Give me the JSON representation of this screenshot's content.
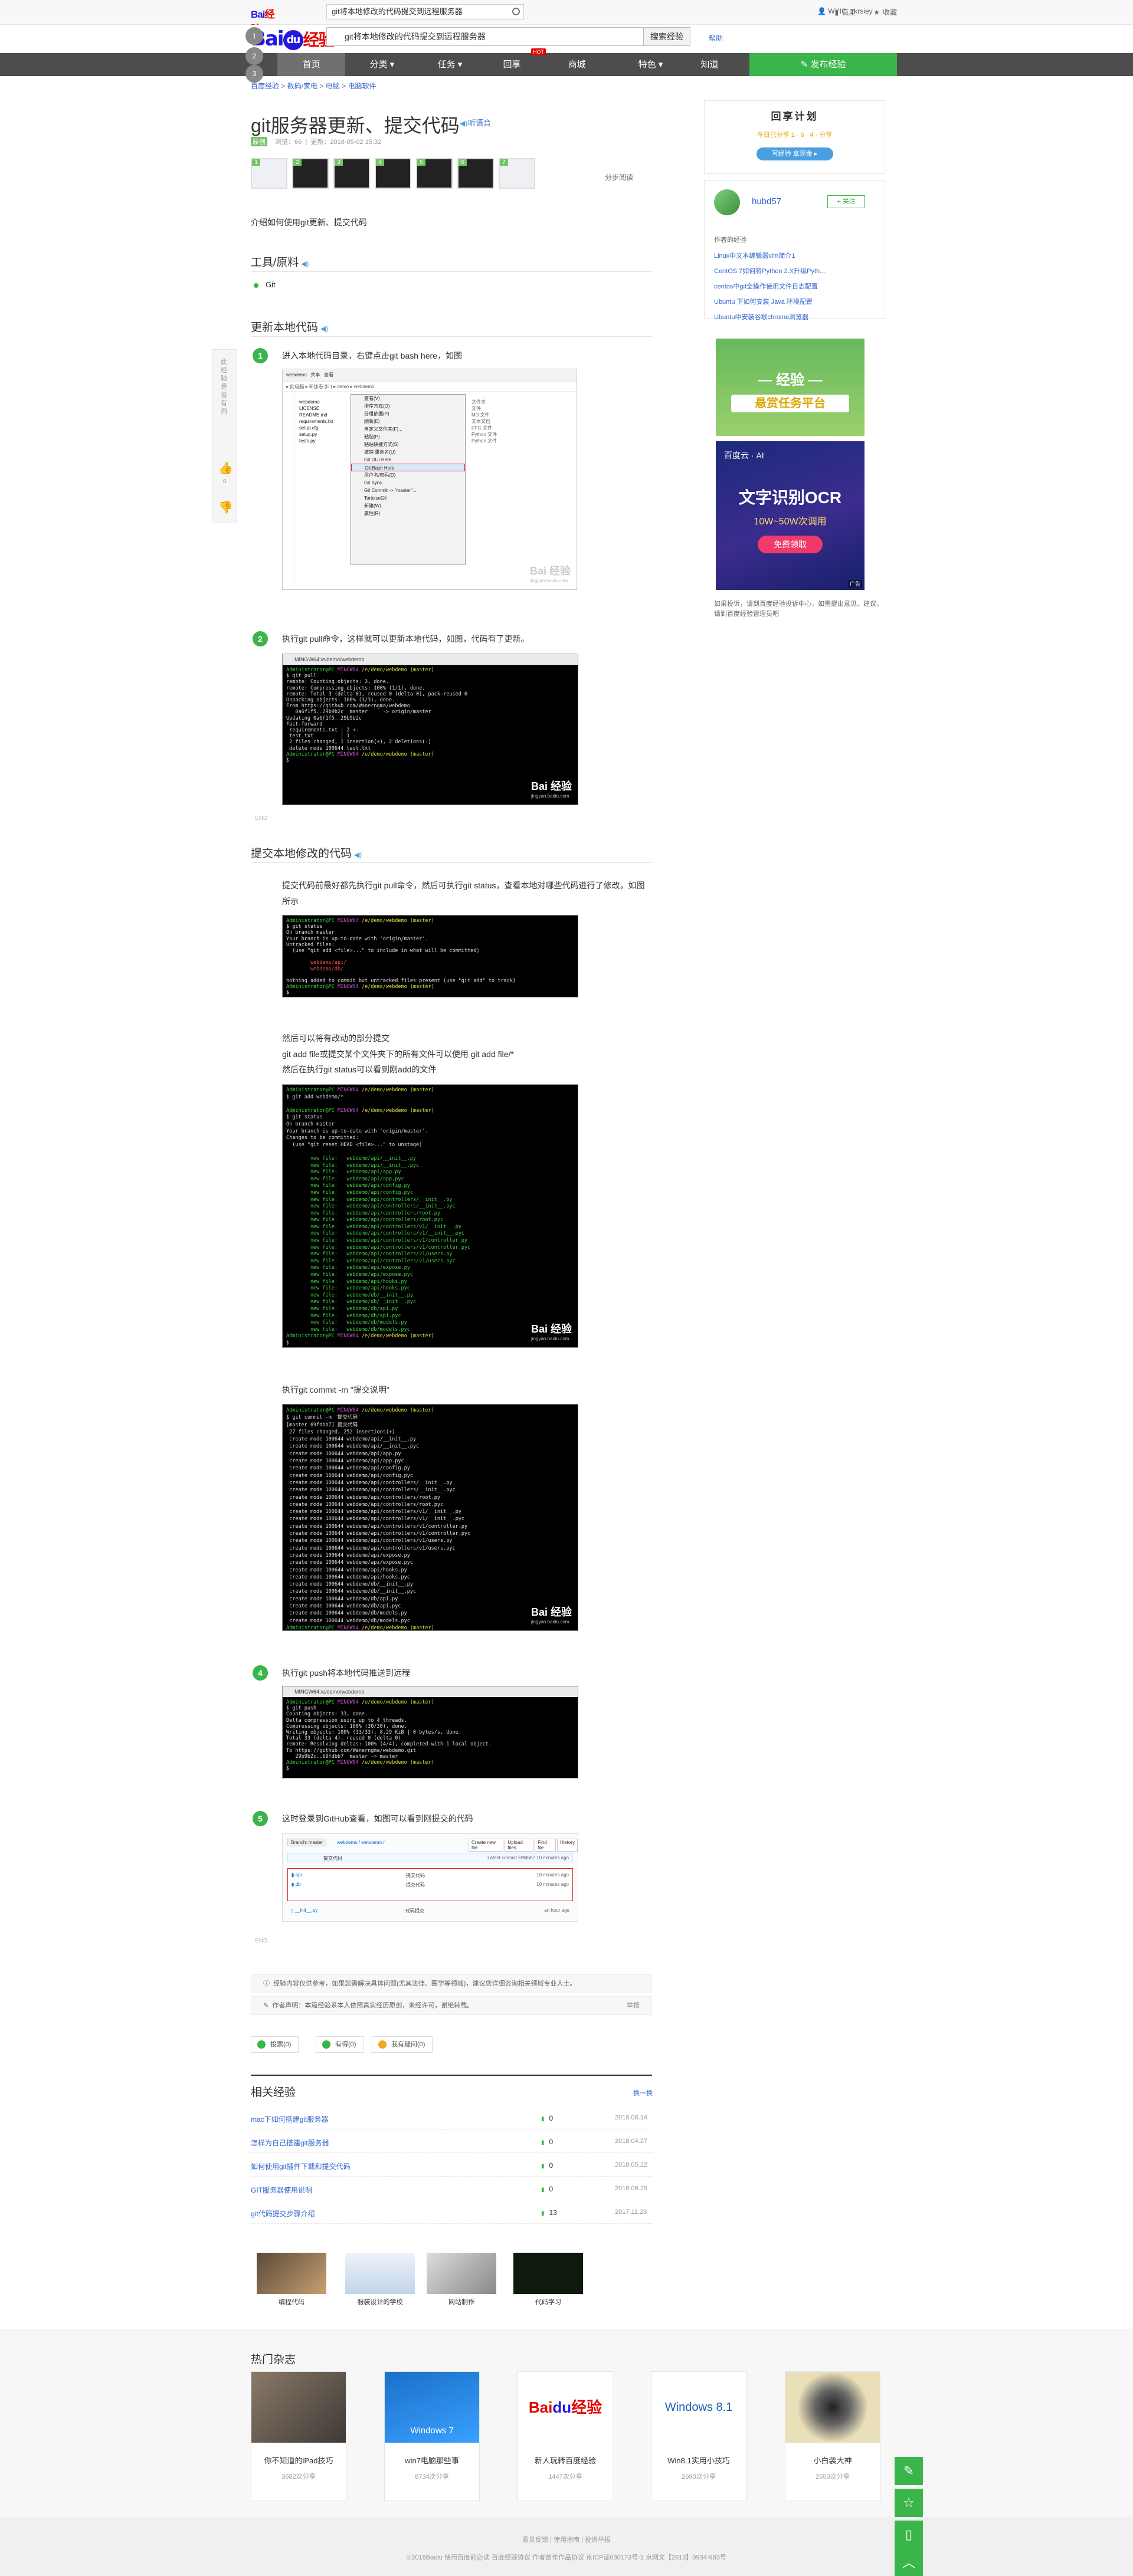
{
  "topbar": {
    "logo_text": "Bai",
    "logo_red": "经验",
    "search_value": "git将本地修改的代码提交到远程服务器",
    "links": [
      "百里",
      "收藏"
    ],
    "user": "WYIC_zkrsiey"
  },
  "header": {
    "logo_text": "Bai",
    "logo_du": "du",
    "logo_jy": "经验",
    "search_value": "git将本地修改的代码提交到远程服务器",
    "search_button": "搜索经验",
    "help": "帮助"
  },
  "nav": {
    "items": [
      "首页",
      "分类 ▾",
      "任务 ▾",
      "回享",
      "商城",
      "特色 ▾",
      "知道"
    ],
    "hot": "HOT",
    "publish": "✎ 发布经验"
  },
  "left_circles": [
    "1",
    "2",
    "3"
  ],
  "breadcrumb": [
    "百度经验",
    "数码/家电",
    "电脑",
    "电脑软件"
  ],
  "article": {
    "title": "git服务器更新、提交代码",
    "listen": "听语音",
    "meta_level": "原创",
    "meta_views": "浏览：66",
    "meta_date": "更新：2018-05-02 15:32",
    "thumbs": [
      "1",
      "2",
      "3",
      "4",
      "5",
      "6",
      "7"
    ],
    "share": "分步阅读",
    "intro": "介绍如何使用git更新、提交代码"
  },
  "sections": {
    "tools_title": "工具/原料",
    "tools": [
      "Git"
    ],
    "update_title": "更新本地代码",
    "commit_title": "提交本地修改的代码"
  },
  "steps": {
    "s1": {
      "num": "1",
      "text": "进入本地代码目录，右键点击git bash here，如图"
    },
    "s2": {
      "num": "2",
      "text": "执行git pull命令，这样就可以更新本地代码，如图，代码有了更新。"
    },
    "c1": {
      "text": "提交代码前最好都先执行git pull命令，然后可执行git status，查看本地对哪些代码进行了修改，如图所示"
    },
    "c2": {
      "line1": "然后可以将有改动的部分提交",
      "line2": "git add file或提交某个文件夹下的所有文件可以使用 git add file/*",
      "line3": "然后在执行git status可以看到刚add的文件"
    },
    "c3": {
      "text": "执行git commit -m \"提交说明\""
    },
    "s4": {
      "num": "4",
      "text": "执行git push将本地代码推送到远程"
    },
    "s5": {
      "num": "5",
      "text": "这时登录到GitHub查看，如图可以看到刚提交的代码"
    }
  },
  "end_label": "END",
  "explorer": {
    "menu": [
      "查看(V)",
      "排序方式(O)",
      "分组依据(P)",
      "刷新(E)",
      "自定义文件夹(F)...",
      "粘贴(P)",
      "粘贴快捷方式(S)",
      "撤销 重命名(U)",
      "Git GUI Here",
      "Git Bash Here",
      "用户名/密码(D)",
      "Git Sync...",
      "Git Commit -> \"master\"...",
      "TortoiseGit",
      "新建(W)",
      "属性(R)"
    ],
    "files": [
      "webdemo",
      "LICENSE",
      "README.md",
      "requirements.txt",
      "setup.cfg",
      "setup.py",
      "tests.py"
    ]
  },
  "terminals": {
    "path": "MINGW64:/e/demo/webdemo",
    "pull": [
      "$ git pull",
      "remote: Counting objects: 3, done.",
      "remote: Compressing objects: 100% (1/1), done.",
      "remote: Total 3 (delta 0), reused 0 (delta 0), pack-reused 0",
      "Unpacking objects: 100% (3/3), done.",
      "From https://github.com/Wanerngma/webdemo",
      "   0a6f1f5..29b9b2c  master     -> origin/master",
      "Updating 0a6f1f5..29b9b2c",
      "Fast-forward",
      " requirements.txt | 2 +-",
      " test.txt         | 1 -",
      " 2 files changed, 1 insertion(+), 2 deletions(-)",
      " delete mode 100644 test.txt"
    ],
    "status": [
      "$ git status",
      "On branch master",
      "Your branch is up-to-date with 'origin/master'.",
      "Untracked files:",
      "  (use \"git add <file>...\" to include in what will be committed)",
      "",
      "        webdemo/api/",
      "        webdemo/db/",
      "",
      "nothing added to commit but untracked files present (use \"git add\" to track)"
    ],
    "add": [
      "$ git add webdemo/*",
      "",
      "$ git status",
      "On branch master",
      "Your branch is up-to-date with 'origin/master'.",
      "Changes to be committed:",
      "  (use \"git reset HEAD <file>...\" to unstage)",
      "",
      "        new file:   webdemo/api/__init__.py",
      "        new file:   webdemo/api/__init__.pyc",
      "        new file:   webdemo/api/app.py",
      "        new file:   webdemo/api/app.pyc",
      "        new file:   webdemo/api/config.py",
      "        new file:   webdemo/api/config.pyc",
      "        new file:   webdemo/api/controllers/__init__.py",
      "        new file:   webdemo/api/controllers/__init__.pyc",
      "        new file:   webdemo/api/controllers/root.py",
      "        new file:   webdemo/api/controllers/root.pyc",
      "        new file:   webdemo/api/controllers/v1/__init__.py",
      "        new file:   webdemo/api/controllers/v1/__init__.pyc",
      "        new file:   webdemo/api/controllers/v1/controller.py",
      "        new file:   webdemo/api/controllers/v1/controller.pyc",
      "        new file:   webdemo/api/controllers/v1/users.py",
      "        new file:   webdemo/api/controllers/v1/users.pyc",
      "        new file:   webdemo/api/expose.py",
      "        new file:   webdemo/api/expose.pyc",
      "        new file:   webdemo/api/hooks.py",
      "        new file:   webdemo/api/hooks.pyc",
      "        new file:   webdemo/db/__init__.py",
      "        new file:   webdemo/db/__init__.pyc",
      "        new file:   webdemo/db/api.py",
      "        new file:   webdemo/db/api.pyc",
      "        new file:   webdemo/db/models.py",
      "        new file:   webdemo/db/models.pyc"
    ],
    "commit": [
      "$ git commit -m '提交代码'",
      "[master 69fdbb7] 提交代码",
      " 27 files changed, 252 insertions(+)",
      " create mode 100644 webdemo/api/__init__.py",
      " create mode 100644 webdemo/api/__init__.pyc",
      " create mode 100644 webdemo/api/app.py",
      " create mode 100644 webdemo/api/app.pyc",
      " create mode 100644 webdemo/api/config.py",
      " create mode 100644 webdemo/api/config.pyc",
      " create mode 100644 webdemo/api/controllers/__init__.py",
      " create mode 100644 webdemo/api/controllers/__init__.pyc",
      " create mode 100644 webdemo/api/controllers/root.py",
      " create mode 100644 webdemo/api/controllers/root.pyc",
      " create mode 100644 webdemo/api/controllers/v1/__init__.py",
      " create mode 100644 webdemo/api/controllers/v1/__init__.pyc",
      " create mode 100644 webdemo/api/controllers/v1/controller.py",
      " create mode 100644 webdemo/api/controllers/v1/controller.pyc",
      " create mode 100644 webdemo/api/controllers/v1/users.py",
      " create mode 100644 webdemo/api/controllers/v1/users.pyc",
      " create mode 100644 webdemo/api/expose.py",
      " create mode 100644 webdemo/api/expose.pyc",
      " create mode 100644 webdemo/api/hooks.py",
      " create mode 100644 webdemo/api/hooks.pyc",
      " create mode 100644 webdemo/db/__init__.py",
      " create mode 100644 webdemo/db/__init__.pyc",
      " create mode 100644 webdemo/db/api.py",
      " create mode 100644 webdemo/db/api.pyc",
      " create mode 100644 webdemo/db/models.py",
      " create mode 100644 webdemo/db/models.pyc"
    ],
    "push": [
      "$ git push",
      "Counting objects: 33, done.",
      "Delta compression using up to 4 threads.",
      "Compressing objects: 100% (30/30), done.",
      "Writing objects: 100% (33/33), 8.29 KiB | 0 bytes/s, done.",
      "Total 33 (delta 4), reused 0 (delta 0)",
      "remote: Resolving deltas: 100% (4/4), completed with 1 local object.",
      "To https://github.com/Wanerngma/webdemo.git",
      "   29b9b2c..69fdbb7  master -> master"
    ],
    "prompt": "/e/demo/webdemo (master)",
    "watermark": "Bai 经验",
    "watermark_url": "jingyan.baidu.com"
  },
  "github": {
    "branch": "Branch: master",
    "path": "webdemo / webdemo /",
    "buttons": [
      "Create new file",
      "Upload files",
      "Find file",
      "History"
    ],
    "commit_msg": "提交代码",
    "latest": "Latest commit 69fdbb7 10 minutes ago",
    "rows": [
      {
        "name": "api",
        "msg": "提交代码",
        "age": "10 minutes ago"
      },
      {
        "name": "db",
        "msg": "提交代码",
        "age": "10 minutes ago"
      },
      {
        "name": "__init__.py",
        "msg": "代码提交",
        "age": "an hour ago"
      }
    ]
  },
  "notes": {
    "n1": "经验内容仅供参考，如果您需解决具体问题(尤其法律、医学等领域)，建议您详细咨询相关领域专业人士。",
    "n2": "作者声明：本篇经验系本人依照真实经历原创，未经许可，谢绝转载。",
    "report": "举报"
  },
  "actions": [
    "投票(0)",
    "有得(0)",
    "我有疑问(0)"
  ],
  "related": {
    "title": "相关经验",
    "more": "换一换",
    "rows": [
      {
        "t": "mac下如何搭建git服务器",
        "v": "0",
        "d": "2018.06.14"
      },
      {
        "t": "怎样为自己搭建git服务器",
        "v": "0",
        "d": "2018.04.27"
      },
      {
        "t": "如何使用git插件下载和提交代码",
        "v": "0",
        "d": "2018.05.22"
      },
      {
        "t": "GIT服务器使用说明",
        "v": "0",
        "d": "2018.06.25"
      },
      {
        "t": "git代码提交步骤介绍",
        "v": "13",
        "d": "2017.11.28"
      }
    ],
    "tiles": [
      "编程代码",
      "服装设计的学校",
      "网站制作",
      "代码学习"
    ]
  },
  "magazine": {
    "title": "热门杂志",
    "items": [
      {
        "t": "你不知道的iPad技巧",
        "c": "3682次分享"
      },
      {
        "t": "win7电脑那些事",
        "c": "8734次分享"
      },
      {
        "t": "新人玩转百度经验",
        "c": "1447次分享"
      },
      {
        "t": "Win8.1实用小技巧",
        "c": "2690次分享"
      },
      {
        "t": "小白装大神",
        "c": "2650次分享"
      }
    ],
    "win7": "Windows 7",
    "win81": "Windows 8.1"
  },
  "footer": {
    "links": "意见反馈 | 使用指南 | 投诉举报",
    "copy": "©2018Baidu  使用百度前必读  百度经验协议  作者创作作品协议  京ICP证030173号-1  京网文【2013】0934-983号"
  },
  "sidebar": {
    "plan_title": "回享计划",
    "plan_stats": "今日已分享 1 · 6 · 4 · 分享",
    "plan_btn": "写经验 拿现金 ▸",
    "author": "hubd57",
    "follow": "+ 关注",
    "author_label": "作者的经验",
    "author_list": [
      "Linux中文本编辑器vim简介1",
      "CentOS 7如何将Python 2.X升级Pyth...",
      "centos中git全操作使用文件日志配置",
      "Ubuntu 下如何安装 Java 环境配置",
      "Ubuntu中安装谷歌chrome浏览器"
    ],
    "ad1_title": "— 经验 —",
    "ad1_sub": "悬赏任务平台",
    "ad2_brand": "百度云 · AI",
    "ad2_title": "文字识别OCR",
    "ad2_sub": "10W~50W次调用",
    "ad2_btn": "免费领取",
    "ad_tag": "广告",
    "note": "如果投诉，请到百度经验投诉中心，如需提出意见、建议，请到百度经验管理员吧"
  },
  "float_left": {
    "label": "此经验是否有用",
    "like": "0",
    "dislike": ""
  },
  "float_right": [
    "✎",
    "☆",
    "▯",
    "︿"
  ]
}
